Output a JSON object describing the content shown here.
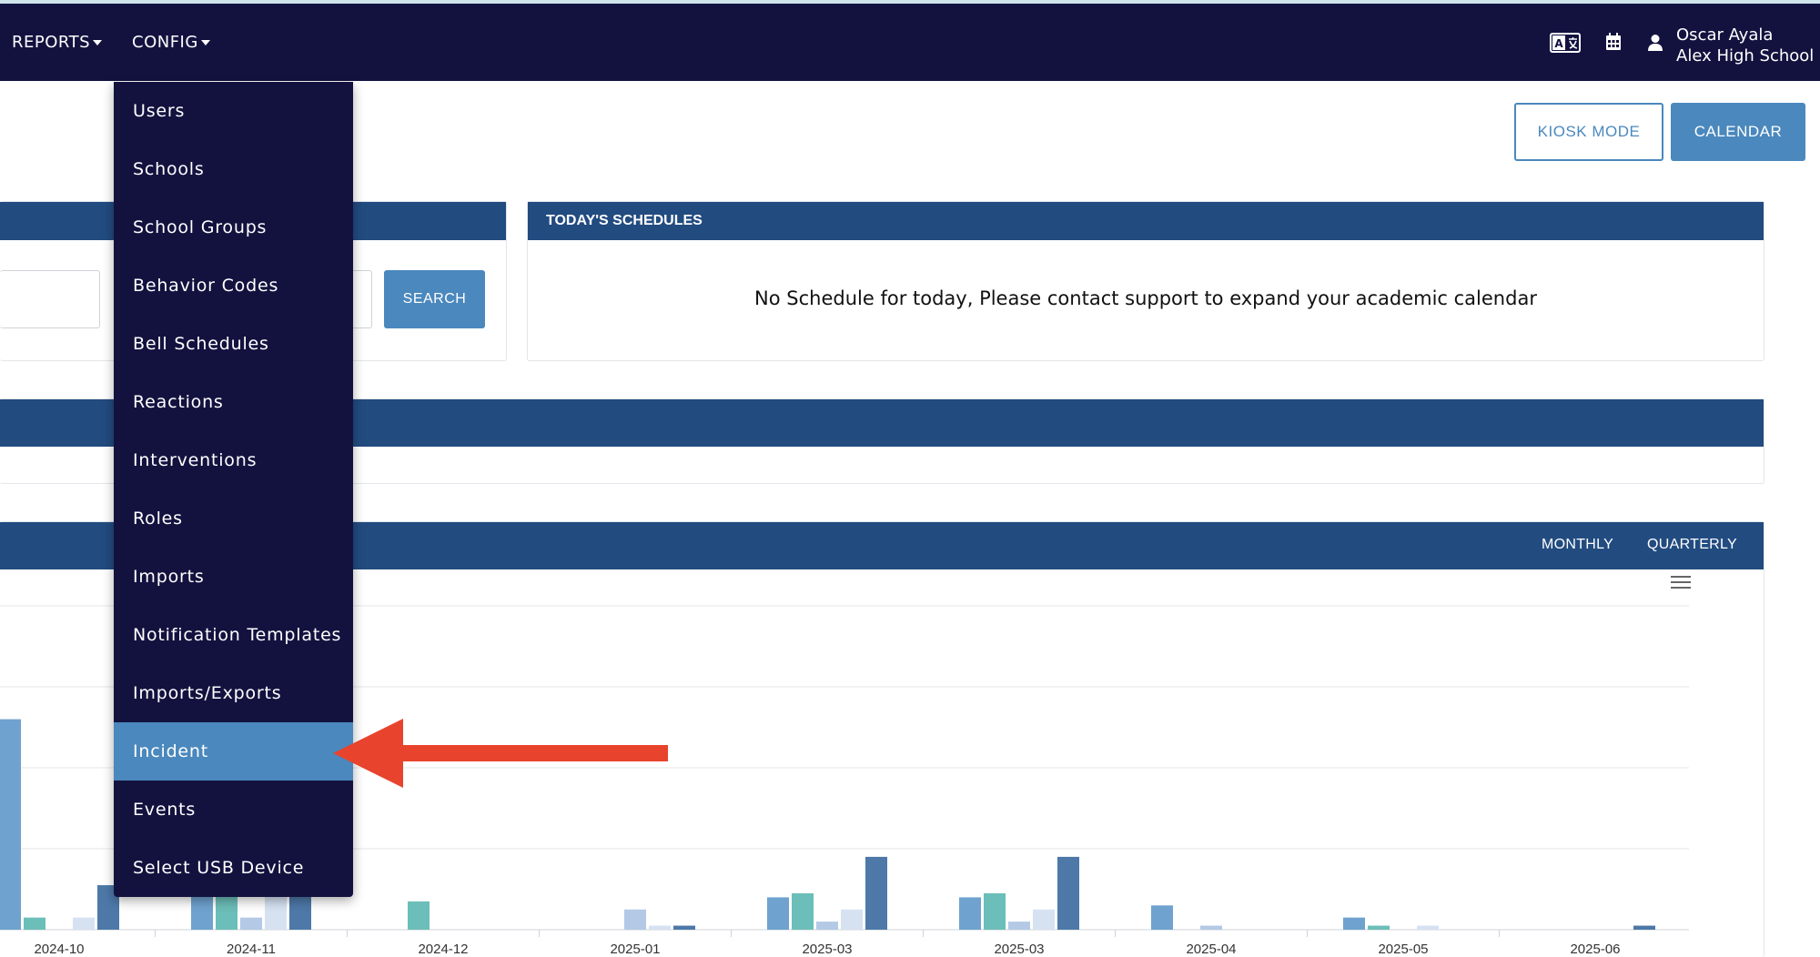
{
  "nav": {
    "reports_label": "REPORTS",
    "config_label": "CONFIG",
    "icons": [
      "translate-icon",
      "calendar-icon",
      "user-icon"
    ],
    "user_name": "Oscar Ayala",
    "user_school": "Alex High School",
    "bg_color": "#13123f"
  },
  "header": {
    "kiosk_label": "KIOSK MODE",
    "calendar_label": "CALENDAR",
    "accent_color": "#4a88bd"
  },
  "search_panel": {
    "search_label": "SEARCH"
  },
  "schedules_panel": {
    "title": "TODAY'S SCHEDULES",
    "message": "No Schedule for today, Please contact support to expand your academic calendar"
  },
  "chart_panel": {
    "tabs": [
      "MONTHLY",
      "QUARTERLY"
    ],
    "menu_icon": "hamburger-menu-icon"
  },
  "chart_data": {
    "type": "bar",
    "categories": [
      "2024-10",
      "2024-11",
      "2024-12",
      "2025-01",
      "2025-03",
      "2025-03",
      "2025-04",
      "2025-05",
      "2025-06"
    ],
    "series": [
      {
        "color": "#6fa2cf",
        "values": [
          2.6,
          0.6,
          0,
          0,
          0.4,
          0.4,
          0.3,
          0.15,
          0
        ]
      },
      {
        "color": "#6cbeb8",
        "values": [
          0.15,
          0.6,
          0.35,
          0,
          0.45,
          0.45,
          0,
          0.05,
          0
        ]
      },
      {
        "color": "#b3c9e5",
        "values": [
          0,
          0.15,
          0,
          0.25,
          0.1,
          0.1,
          0.05,
          0,
          0
        ]
      },
      {
        "color": "#d6e2f2",
        "values": [
          0.15,
          0.5,
          0,
          0.05,
          0.25,
          0.25,
          0,
          0.05,
          0
        ]
      },
      {
        "color": "#4d78a8",
        "values": [
          0.55,
          0.45,
          0,
          0.05,
          0.9,
          0.9,
          0,
          0,
          0.05
        ]
      }
    ],
    "ylim": [
      0,
      4
    ],
    "grid": true
  },
  "dropdown": {
    "items": [
      "Users",
      "Schools",
      "School Groups",
      "Behavior Codes",
      "Bell Schedules",
      "Reactions",
      "Interventions",
      "Roles",
      "Imports",
      "Notification Templates",
      "Imports/Exports",
      "Incident",
      "Events",
      "Select USB Device"
    ],
    "active_item": "Incident"
  },
  "annotation": {
    "arrow_color": "#e8432c"
  }
}
